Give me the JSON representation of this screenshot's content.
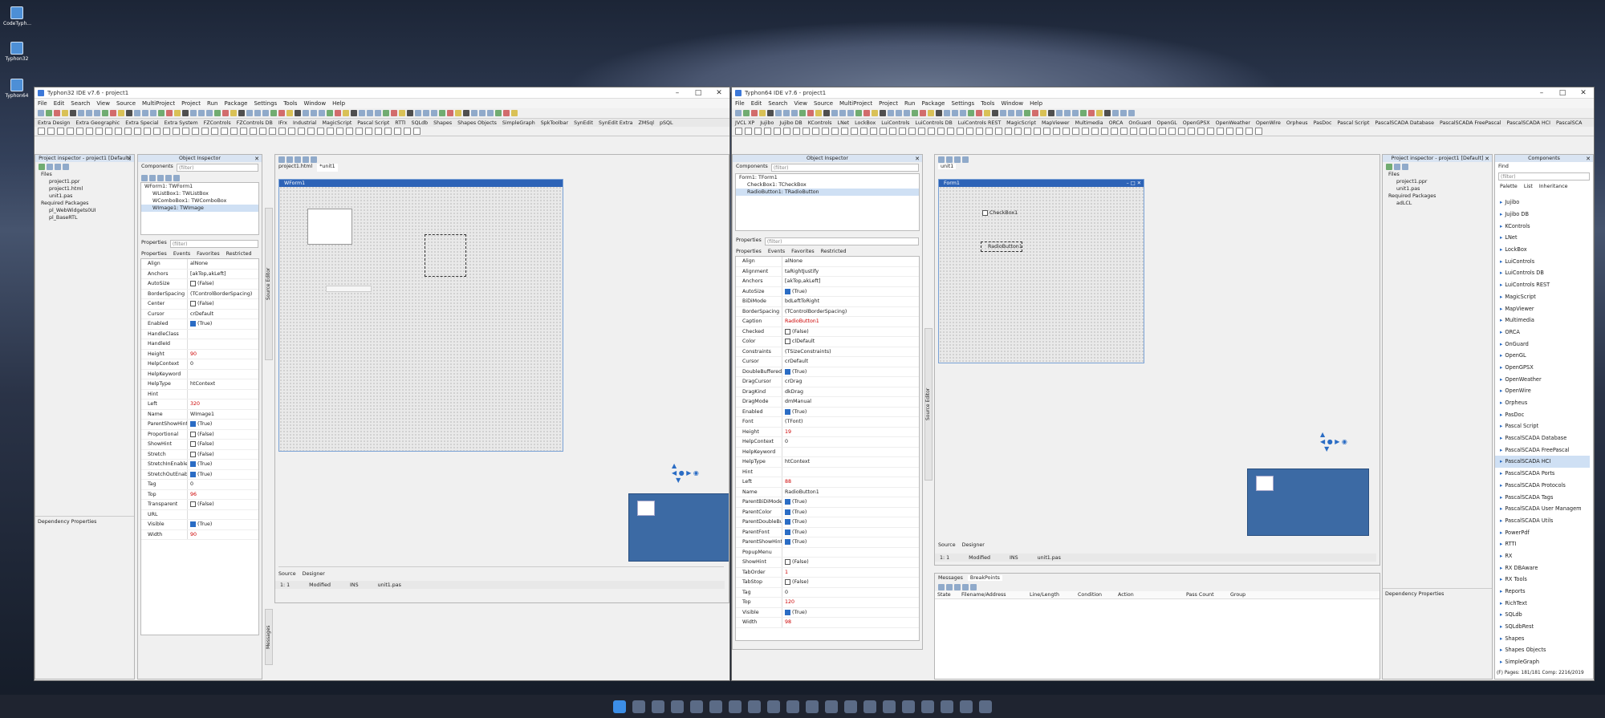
{
  "desktop": {
    "icons": [
      "CodeTyph...",
      "Typhon32",
      "Typhon64"
    ]
  },
  "left": {
    "title": "Typhon32 IDE v7.6 - project1",
    "menu": [
      "File",
      "Edit",
      "Search",
      "View",
      "Source",
      "MultiProject",
      "Project",
      "Run",
      "Package",
      "Settings",
      "Tools",
      "Window",
      "Help"
    ],
    "palette_tabs": [
      "Extra Design",
      "Extra Geographic",
      "Extra Special",
      "Extra System",
      "FZControls",
      "FZControls DB",
      "IFrx",
      "Industrial",
      "MagicScript",
      "Pascal Script",
      "RTTI",
      "SQLdb",
      "Shapes",
      "Shapes Objects",
      "SimpleGraph",
      "SpkToolbar",
      "SynEdit",
      "SynEdit Extra",
      "ZMSql",
      "pSQL"
    ],
    "project_inspector": {
      "title": "Project inspector - project1 [Default]",
      "items": [
        "Files",
        "project1.ppr",
        "project1.html",
        "unit1.pas",
        "Required Packages",
        "pl_WebWidgets0UI",
        "pl_BaseRTL"
      ],
      "footer": "Dependency Properties"
    },
    "object_inspector": {
      "title": "Object Inspector",
      "components_label": "Components",
      "filter": "(filter)",
      "tree": [
        "WForm1: TWForm1",
        "WListBox1: TWListBox",
        "WComboBox1: TWComboBox",
        "WImage1: TWImage"
      ],
      "props_label": "Properties",
      "tabs": [
        "Properties",
        "Events",
        "Favorites",
        "Restricted"
      ],
      "rows": [
        [
          "Align",
          "alNone",
          ""
        ],
        [
          "Anchors",
          "[akTop,akLeft]",
          ""
        ],
        [
          "AutoSize",
          "(False)",
          "off"
        ],
        [
          "BorderSpacing",
          "(TControlBorderSpacing)",
          ""
        ],
        [
          "Center",
          "(False)",
          "off"
        ],
        [
          "Cursor",
          "crDefault",
          ""
        ],
        [
          "Enabled",
          "(True)",
          "on"
        ],
        [
          "HandleClass",
          "",
          ""
        ],
        [
          "HandleId",
          "",
          ""
        ],
        [
          "Height",
          "90",
          "red"
        ],
        [
          "HelpContext",
          "0",
          ""
        ],
        [
          "HelpKeyword",
          "",
          ""
        ],
        [
          "HelpType",
          "htContext",
          ""
        ],
        [
          "Hint",
          "",
          ""
        ],
        [
          "Left",
          "320",
          "red"
        ],
        [
          "Name",
          "WImage1",
          ""
        ],
        [
          "ParentShowHint",
          "(True)",
          "on"
        ],
        [
          "Proportional",
          "(False)",
          "off"
        ],
        [
          "ShowHint",
          "(False)",
          "off"
        ],
        [
          "Stretch",
          "(False)",
          "off"
        ],
        [
          "StretchInEnable",
          "(True)",
          "on"
        ],
        [
          "StretchOutEnab",
          "(True)",
          "on"
        ],
        [
          "Tag",
          "0",
          ""
        ],
        [
          "Top",
          "96",
          "red"
        ],
        [
          "Transparent",
          "(False)",
          "off"
        ],
        [
          "URL",
          "",
          ""
        ],
        [
          "Visible",
          "(True)",
          "on"
        ],
        [
          "Width",
          "90",
          "red"
        ]
      ]
    },
    "editor": {
      "tabs": [
        "project1.html",
        "*unit1"
      ],
      "form_caption": "WForm1",
      "source_tab": "Source",
      "designer_tab": "Designer",
      "status": [
        "1: 1",
        "Modified",
        "INS",
        "unit1.pas"
      ],
      "side_tab": "Source Editor",
      "messages_tab": "Messages"
    }
  },
  "right": {
    "title": "Typhon64 IDE v7.6 - project1",
    "menu": [
      "File",
      "Edit",
      "Search",
      "View",
      "Source",
      "MultiProject",
      "Project",
      "Run",
      "Package",
      "Settings",
      "Tools",
      "Window",
      "Help"
    ],
    "palette_tabs": [
      "JVCL XP",
      "Jujibo",
      "Jujibo DB",
      "KControls",
      "LNet",
      "LockBox",
      "LuiControls",
      "LuiControls DB",
      "LuiControls REST",
      "MagicScript",
      "MapViewer",
      "Multimedia",
      "ORCA",
      "OnGuard",
      "OpenGL",
      "OpenGPSX",
      "OpenWeather",
      "OpenWire",
      "Orpheus",
      "PasDoc",
      "Pascal Script",
      "PascalSCADA Database",
      "PascalSCADA FreePascal",
      "PascalSCADA HCI",
      "PascalSCA"
    ],
    "object_inspector": {
      "title": "Object Inspector",
      "components_label": "Components",
      "filter": "(filter)",
      "tree": [
        "Form1: TForm1",
        "CheckBox1: TCheckBox",
        "RadioButton1: TRadioButton"
      ],
      "props_label": "Properties",
      "tabs": [
        "Properties",
        "Events",
        "Favorites",
        "Restricted"
      ],
      "rows": [
        [
          "Align",
          "alNone",
          ""
        ],
        [
          "Alignment",
          "taRightJustify",
          ""
        ],
        [
          "Anchors",
          "[akTop,akLeft]",
          ""
        ],
        [
          "AutoSize",
          "(True)",
          "on"
        ],
        [
          "BiDiMode",
          "bdLeftToRight",
          ""
        ],
        [
          "BorderSpacing",
          "(TControlBorderSpacing)",
          ""
        ],
        [
          "Caption",
          "RadioButton1",
          "red"
        ],
        [
          "Checked",
          "(False)",
          "off"
        ],
        [
          "Color",
          "clDefault",
          "box"
        ],
        [
          "Constraints",
          "(TSizeConstraints)",
          ""
        ],
        [
          "Cursor",
          "crDefault",
          ""
        ],
        [
          "DoubleBuffered",
          "(True)",
          "on"
        ],
        [
          "DragCursor",
          "crDrag",
          ""
        ],
        [
          "DragKind",
          "dkDrag",
          ""
        ],
        [
          "DragMode",
          "dmManual",
          ""
        ],
        [
          "Enabled",
          "(True)",
          "on"
        ],
        [
          "Font",
          "(TFont)",
          ""
        ],
        [
          "Height",
          "19",
          "red"
        ],
        [
          "HelpContext",
          "0",
          ""
        ],
        [
          "HelpKeyword",
          "",
          ""
        ],
        [
          "HelpType",
          "htContext",
          ""
        ],
        [
          "Hint",
          "",
          ""
        ],
        [
          "Left",
          "88",
          "red"
        ],
        [
          "Name",
          "RadioButton1",
          ""
        ],
        [
          "ParentBiDiMode",
          "(True)",
          "on"
        ],
        [
          "ParentColor",
          "(True)",
          "on"
        ],
        [
          "ParentDoubleBu",
          "(True)",
          "on"
        ],
        [
          "ParentFont",
          "(True)",
          "on"
        ],
        [
          "ParentShowHint",
          "(True)",
          "on"
        ],
        [
          "PopupMenu",
          "",
          ""
        ],
        [
          "ShowHint",
          "(False)",
          "off"
        ],
        [
          "TabOrder",
          "1",
          "red"
        ],
        [
          "TabStop",
          "(False)",
          "off"
        ],
        [
          "Tag",
          "0",
          ""
        ],
        [
          "Top",
          "120",
          "red"
        ],
        [
          "Visible",
          "(True)",
          "on"
        ],
        [
          "Width",
          "98",
          "red"
        ]
      ]
    },
    "editor": {
      "tab": "unit1",
      "form_caption": "Form1",
      "checkbox_caption": "CheckBox1",
      "radio_caption": "RadioButton1",
      "source_tab": "Source",
      "designer_tab": "Designer",
      "status": [
        "1: 1",
        "Modified",
        "INS",
        "unit1.pas"
      ],
      "side_tab": "Source Editor"
    },
    "messages": {
      "tabs": [
        "Messages",
        "BreakPoints"
      ],
      "columns": [
        "State",
        "Filename/Address",
        "Line/Length",
        "Condition",
        "Action",
        "Pass Count",
        "Group"
      ]
    },
    "project_inspector": {
      "title": "Project inspector - project1 [Default]",
      "items": [
        "Files",
        "project1.ppr",
        "unit1.pas",
        "Required Packages",
        "adLCL"
      ],
      "footer": "Dependency Properties"
    },
    "components": {
      "title": "Components",
      "find_label": "Find",
      "find_value": "(filter)",
      "tabs": [
        "Palette",
        "List",
        "Inheritance"
      ],
      "items": [
        "Jujibo",
        "Jujibo DB",
        "KControls",
        "LNet",
        "LockBox",
        "LuiControls",
        "LuiControls DB",
        "LuiControls REST",
        "MagicScript",
        "MapViewer",
        "Multimedia",
        "ORCA",
        "OnGuard",
        "OpenGL",
        "OpenGPSX",
        "OpenWeather",
        "OpenWire",
        "Orpheus",
        "PasDoc",
        "Pascal Script",
        "PascalSCADA Database",
        "PascalSCADA FreePascal",
        "PascalSCADA HCI",
        "PascalSCADA Ports",
        "PascalSCADA Protocols",
        "PascalSCADA Tags",
        "PascalSCADA User Managem",
        "PascalSCADA Utils",
        "PowerPdf",
        "RTTI",
        "RX",
        "RX DBAware",
        "RX Tools",
        "Reports",
        "RichText",
        "SQLdb",
        "SQLdbRest",
        "Shapes",
        "Shapes Objects",
        "SimpleGraph"
      ],
      "selected": "PascalSCADA HCI",
      "footer": "(F) Pages: 181/181 Comp: 2216/2019"
    }
  }
}
